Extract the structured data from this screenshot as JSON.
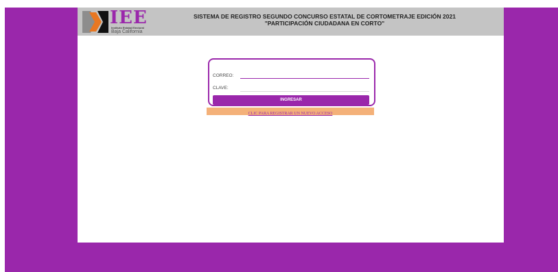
{
  "colors": {
    "brand_purple": "#9a27ab",
    "header_gray": "#c4c4c4",
    "register_bar_orange": "#f4b179",
    "logo_gray": "#8d8d8d",
    "logo_orange": "#e87722",
    "logo_black": "#111111"
  },
  "logo": {
    "wordmark": "IEE",
    "line1": "Instituto Estatal Electoral",
    "line2": "Baja California"
  },
  "header": {
    "title_line1": "SISTEMA DE REGISTRO SEGUNDO CONCURSO ESTATAL DE CORTOMETRAJE EDICIÓN 2021",
    "title_line2": "\"PARTICIPACIÓN CIUDADANA EN CORTO\""
  },
  "login": {
    "correo_label": "CORREO:",
    "correo_value": "",
    "clave_label": "CLAVE:",
    "clave_value": "",
    "submit_label": "INGRESAR"
  },
  "register": {
    "link_label": "CLIC PARA REGISTRAR UN NUEVO ACCESO"
  }
}
